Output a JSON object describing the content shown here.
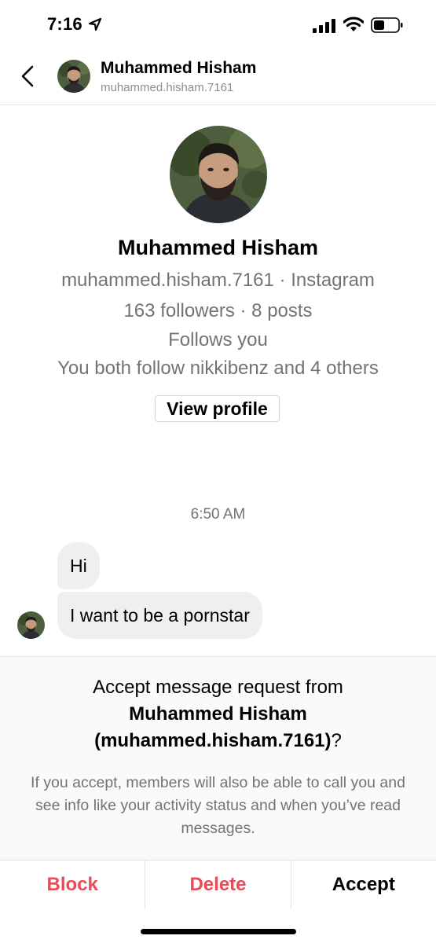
{
  "status_bar": {
    "time": "7:16"
  },
  "header": {
    "name": "Muhammed Hisham",
    "handle": "muhammed.hisham.7161"
  },
  "profile": {
    "name": "Muhammed Hisham",
    "line1": "muhammed.hisham.7161 · Instagram",
    "line2": "163 followers · 8 posts",
    "line3": "Follows you",
    "line4": "You both follow nikkibenz and 4 others",
    "view_profile": "View profile"
  },
  "messages": {
    "timestamp": "6:50 AM",
    "items": [
      "Hi",
      "I want to be a pornstar"
    ]
  },
  "request": {
    "title_prefix": "Accept message request from",
    "title_name": "Muhammed Hisham",
    "title_handle": "(muhammed.hisham.7161)",
    "title_suffix": "?",
    "description": "If you accept, members will also be able to call you and see info like your activity status and when you’ve read messages."
  },
  "actions": {
    "block": "Block",
    "delete": "Delete",
    "accept": "Accept"
  },
  "colors": {
    "danger": "#ed4956",
    "bubble": "#efefef",
    "secondary_text": "#737373"
  }
}
